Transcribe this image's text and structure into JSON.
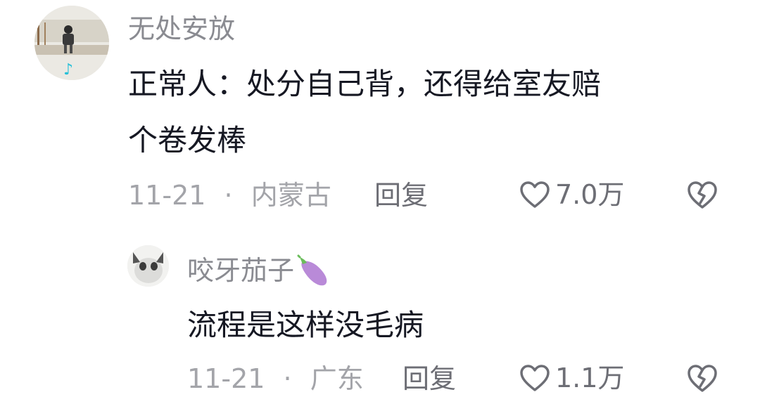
{
  "comments": [
    {
      "username": "无处安放",
      "content_line1": "正常人：处分自己背，还得给室友赔",
      "content_line2": "个卷发棒",
      "date": "11-21",
      "separator": "·",
      "location": "内蒙古",
      "reply_label": "回复",
      "likes": "7.0万"
    },
    {
      "username": "咬牙茄子",
      "username_emoji": "eggplant-emoji",
      "content_line1": "流程是这样没毛病",
      "date": "11-21",
      "separator": "·",
      "location": "广东",
      "reply_label": "回复",
      "likes": "1.1万"
    }
  ],
  "icons": {
    "like": "heart-outline-icon",
    "dislike": "broken-heart-icon"
  },
  "colors": {
    "username": "#8a8b91",
    "content": "#161823",
    "meta": "#a3a4a9",
    "action": "#6d6e75",
    "eggplant": "#b98ad8"
  }
}
